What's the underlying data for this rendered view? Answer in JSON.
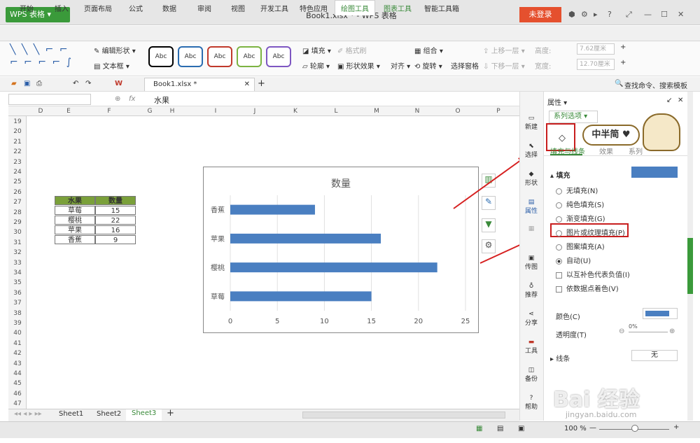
{
  "titlebar": {
    "app": "WPS 表格",
    "doc_title": "Book1.xlsx * - WPS 表格",
    "login": "未登录"
  },
  "menus": [
    "开始",
    "插入",
    "页面布局",
    "公式",
    "数据",
    "审阅",
    "视图",
    "开发工具",
    "特色应用",
    "绘图工具",
    "图表工具",
    "智能工具箱"
  ],
  "ribbon": {
    "edit_shape": "编辑形状",
    "text_box": "文本框",
    "abc": "Abc",
    "fill": "填充",
    "format_brush": "格式刷",
    "outline": "轮廓",
    "shape_effect": "形状效果",
    "group": "组合",
    "align": "对齐",
    "rotate": "旋转",
    "selection_pane": "选择窗格",
    "bring_forward": "上移一层",
    "send_backward": "下移一层",
    "height_label": "高度:",
    "height_value": "7.62厘米",
    "width_label": "宽度:",
    "width_value": "12.70厘米"
  },
  "toolbar": {
    "doc_tab": "Book1.xlsx *",
    "search": "查找命令、搜索模板"
  },
  "formula": {
    "fx": "fx",
    "value": "水果"
  },
  "columns": [
    "D",
    "E",
    "F",
    "G",
    "H",
    "I",
    "J",
    "K",
    "L",
    "M",
    "N",
    "O",
    "P"
  ],
  "rows": [
    "19",
    "20",
    "21",
    "22",
    "23",
    "24",
    "25",
    "26",
    "27",
    "28",
    "29",
    "30",
    "31",
    "32",
    "33",
    "34",
    "35",
    "36",
    "37",
    "38",
    "39",
    "40",
    "41",
    "42",
    "43",
    "44",
    "45",
    "46",
    "47"
  ],
  "table": {
    "headers": [
      "水果",
      "数量"
    ],
    "rows": [
      [
        "草莓",
        "15"
      ],
      [
        "樱桃",
        "22"
      ],
      [
        "苹果",
        "16"
      ],
      [
        "香蕉",
        "9"
      ]
    ]
  },
  "chart_data": {
    "type": "bar",
    "title": "数量",
    "categories": [
      "香蕉",
      "苹果",
      "樱桃",
      "草莓"
    ],
    "values": [
      9,
      16,
      22,
      15
    ],
    "xticks": [
      "0",
      "5",
      "10",
      "15",
      "20",
      "25"
    ],
    "xlim": [
      0,
      25
    ],
    "bar_color": "#4a7fc1"
  },
  "sidebar": [
    "新建",
    "选择",
    "形状",
    "属性",
    "",
    "传图",
    "推荐",
    "分享",
    "工具",
    "备份",
    "帮助"
  ],
  "panel": {
    "title": "属性",
    "series_options": "系列选项",
    "tabs": [
      "填充与线条",
      "效果",
      "系列"
    ],
    "fill_section": "填充",
    "options": [
      "无填充(N)",
      "纯色填充(S)",
      "渐变填充(G)",
      "图片或纹理填充(P)",
      "图案填充(A)",
      "自动(U)"
    ],
    "checkboxes": [
      "以互补色代表负值(I)",
      "依数据点着色(V)"
    ],
    "color_label": "颜色(C)",
    "transparency_label": "透明度(T)",
    "transparency_value": "0%",
    "line_label": "线条",
    "line_value": "无",
    "badge": "中半简"
  },
  "sheets": [
    "Sheet1",
    "Sheet2",
    "Sheet3"
  ],
  "status": {
    "zoom": "100 %"
  },
  "watermark": {
    "brand": "Bai 经验",
    "url": "jingyan.baidu.com"
  }
}
